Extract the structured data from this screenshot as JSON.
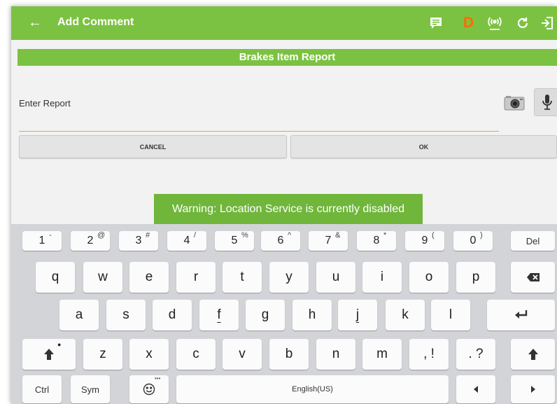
{
  "appbar": {
    "title": "Add Comment",
    "d_label": "D"
  },
  "subtitle": "Brakes Item Report",
  "report": {
    "placeholder": "Enter Report"
  },
  "buttons": {
    "cancel": "CANCEL",
    "ok": "OK"
  },
  "toast": "Warning: Location Service is currently disabled",
  "colors": {
    "accent": "#7cc242",
    "d_icon": "#ff6a00",
    "underline": "#e0a15e"
  },
  "keyboard": {
    "number_row": [
      {
        "main": "1",
        "sub": "-"
      },
      {
        "main": "2",
        "sub": "@"
      },
      {
        "main": "3",
        "sub": "#"
      },
      {
        "main": "4",
        "sub": "/"
      },
      {
        "main": "5",
        "sub": "%"
      },
      {
        "main": "6",
        "sub": "^"
      },
      {
        "main": "7",
        "sub": "&"
      },
      {
        "main": "8",
        "sub": "*"
      },
      {
        "main": "9",
        "sub": "("
      },
      {
        "main": "0",
        "sub": ")"
      }
    ],
    "del": "Del",
    "row_q": [
      "q",
      "w",
      "e",
      "r",
      "t",
      "y",
      "u",
      "i",
      "o",
      "p"
    ],
    "row_a": [
      "a",
      "s",
      "d",
      "f",
      "g",
      "h",
      "j",
      "k",
      "l"
    ],
    "row_z": [
      "z",
      "x",
      "c",
      "v",
      "b",
      "n",
      "m"
    ],
    "comma_key": ", !",
    "period_key": ". ?",
    "ctrl": "Ctrl",
    "sym": "Sym",
    "space": "English(US)",
    "icons": [
      "back-arrow",
      "message",
      "radio-signal",
      "refresh",
      "logout",
      "camera",
      "microphone",
      "backspace",
      "enter",
      "shift",
      "emoji",
      "arrow-left",
      "arrow-right"
    ]
  }
}
